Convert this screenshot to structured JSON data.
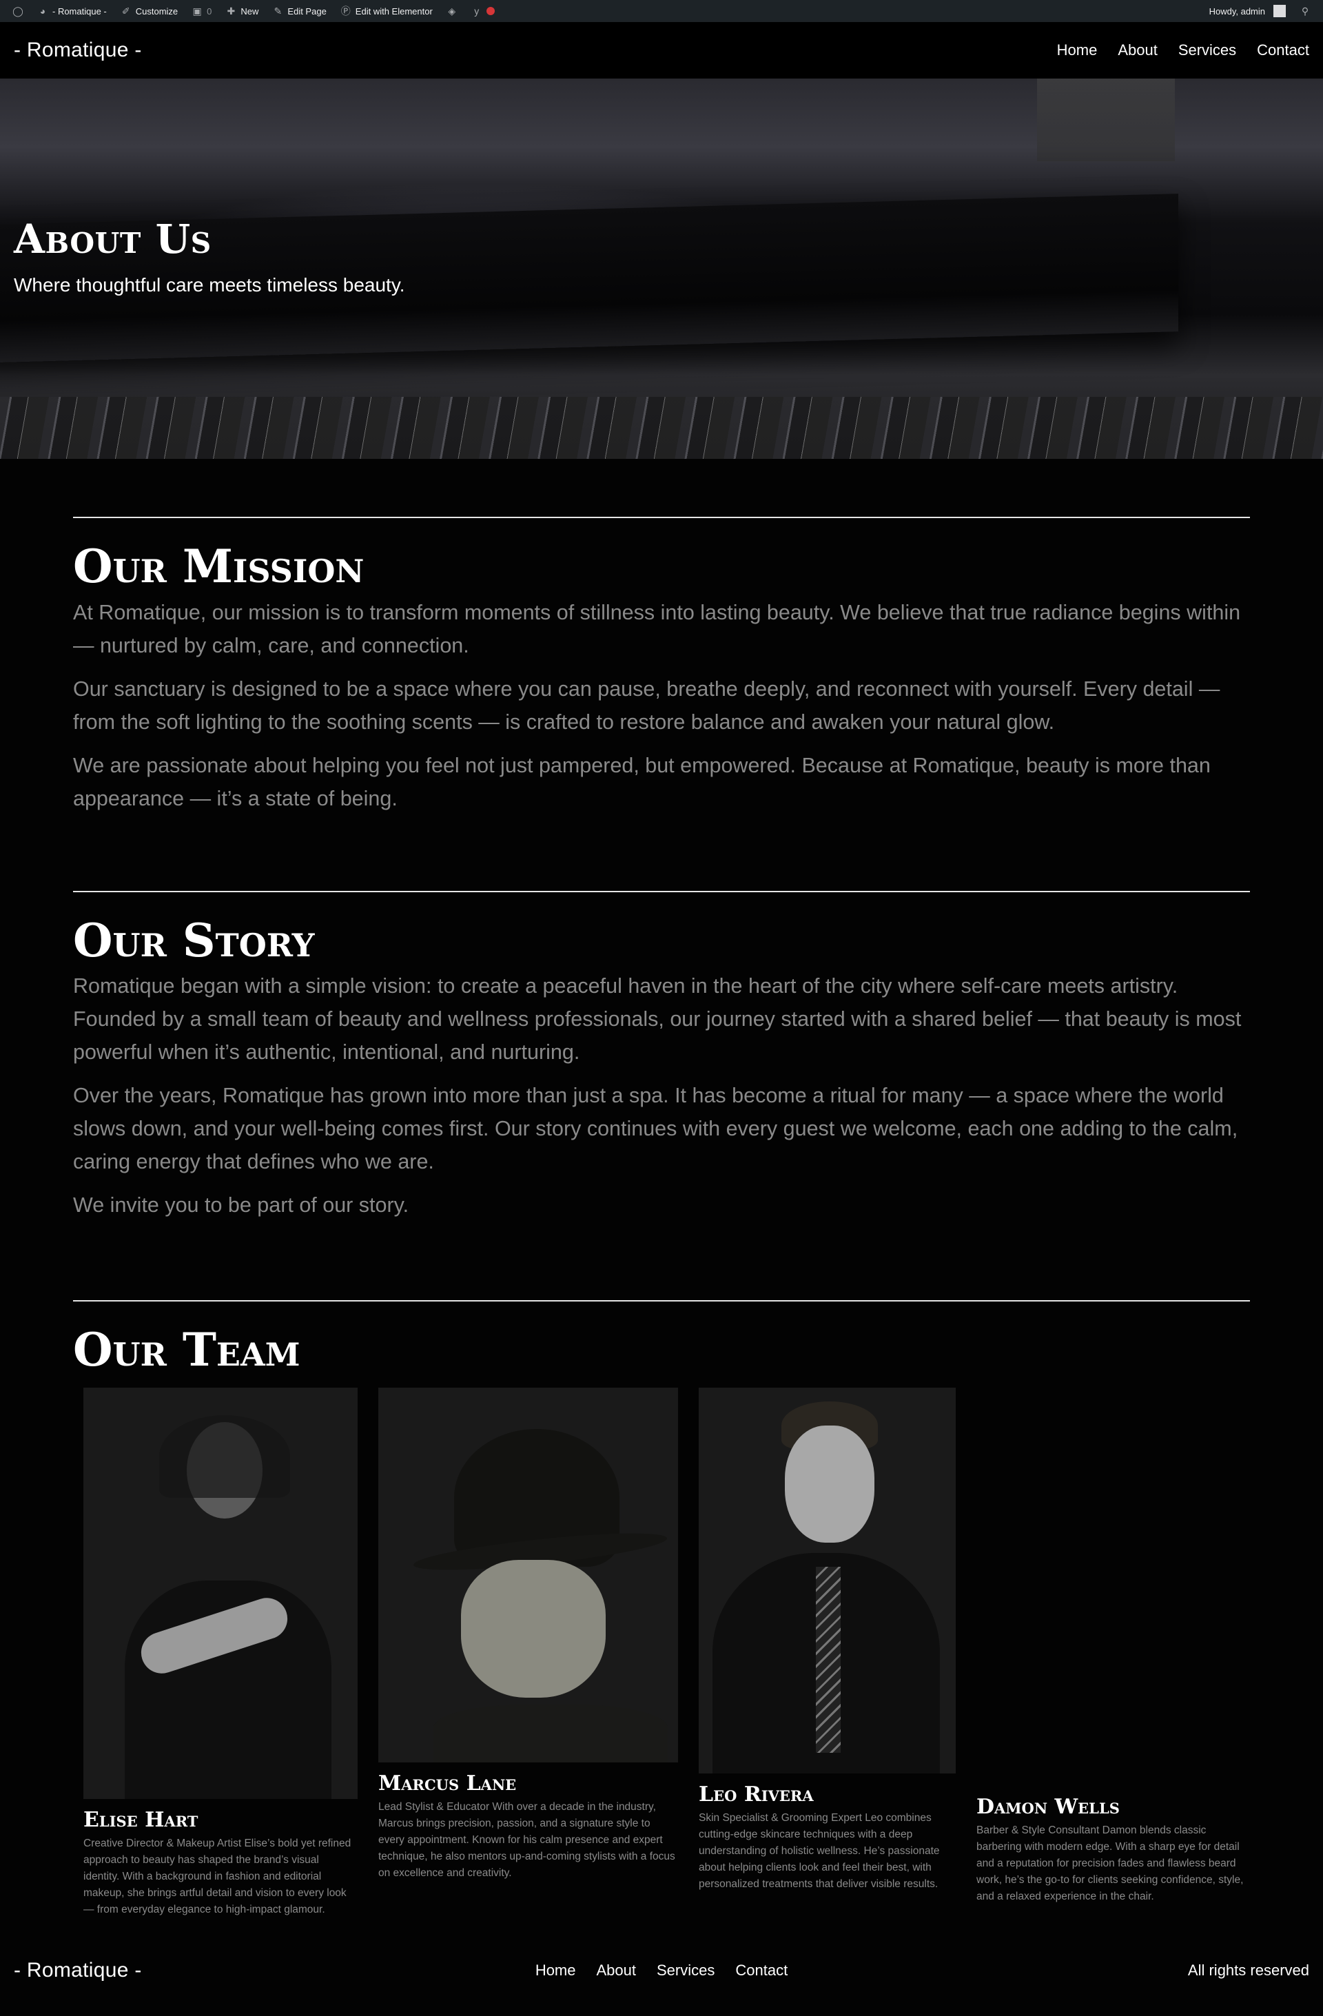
{
  "adminbar": {
    "site": "- Romatique -",
    "customize": "Customize",
    "comments": "0",
    "new": "New",
    "edit_page": "Edit Page",
    "elementor": "Edit with Elementor",
    "howdy": "Howdy, admin"
  },
  "header": {
    "logo": "- Romatique -",
    "nav": [
      "Home",
      "About",
      "Services",
      "Contact"
    ]
  },
  "hero": {
    "title": "About Us",
    "subtitle": "Where thoughtful care meets timeless beauty."
  },
  "mission": {
    "title": "Our Mission",
    "paragraphs": [
      "At Romatique, our mission is to transform moments of stillness into lasting beauty. We believe that true radiance begins within — nurtured by calm, care, and connection.",
      "Our sanctuary is designed to be a space where you can pause, breathe deeply, and reconnect with yourself. Every detail — from the soft lighting to the soothing scents — is crafted to restore balance and awaken your natural glow.",
      "We are passionate about helping you feel not just pampered, but empowered. Because at Romatique, beauty is more than appearance — it’s a state of being."
    ]
  },
  "story": {
    "title": "Our Story",
    "paragraphs": [
      "Romatique began with a simple vision: to create a peaceful haven in the heart of the city where self-care meets artistry. Founded by a small team of beauty and wellness professionals, our journey started with a shared belief — that beauty is most powerful when it’s authentic, intentional, and nurturing.",
      "Over the years, Romatique has grown into more than just a spa. It has become a ritual for many — a space where the world slows down, and your well-being comes first. Our story continues with every guest we welcome, each one adding to the calm, caring energy that defines who we are.",
      "We invite you to be part of our story."
    ]
  },
  "team": {
    "title": "Our Team",
    "members": [
      {
        "name": "Elise Hart",
        "bio": "Creative Director & Makeup Artist Elise’s bold yet refined approach to beauty has shaped the brand’s visual identity. With a background in fashion and editorial makeup, she brings artful detail and vision to every look — from everyday elegance to high-impact glamour."
      },
      {
        "name": "Marcus Lane",
        "bio": "Lead Stylist & Educator With over a decade in the industry, Marcus brings precision, passion, and a signature style to every appointment. Known for his calm presence and expert technique, he also mentors up-and-coming stylists with a focus on excellence and creativity."
      },
      {
        "name": "Leo Rivera",
        "bio": "Skin Specialist & Grooming Expert Leo combines cutting-edge skincare techniques with a deep understanding of holistic wellness. He’s passionate about helping clients look and feel their best, with personalized treatments that deliver visible results."
      },
      {
        "name": "Damon Wells",
        "bio": "Barber & Style Consultant Damon blends classic barbering with modern edge. With a sharp eye for detail and a reputation for precision fades and flawless beard work, he’s the go-to for clients seeking confidence, style, and a relaxed experience in the chair."
      }
    ]
  },
  "footer": {
    "logo": "- Romatique -",
    "nav": [
      "Home",
      "About",
      "Services",
      "Contact"
    ],
    "copy": "All rights reserved"
  }
}
